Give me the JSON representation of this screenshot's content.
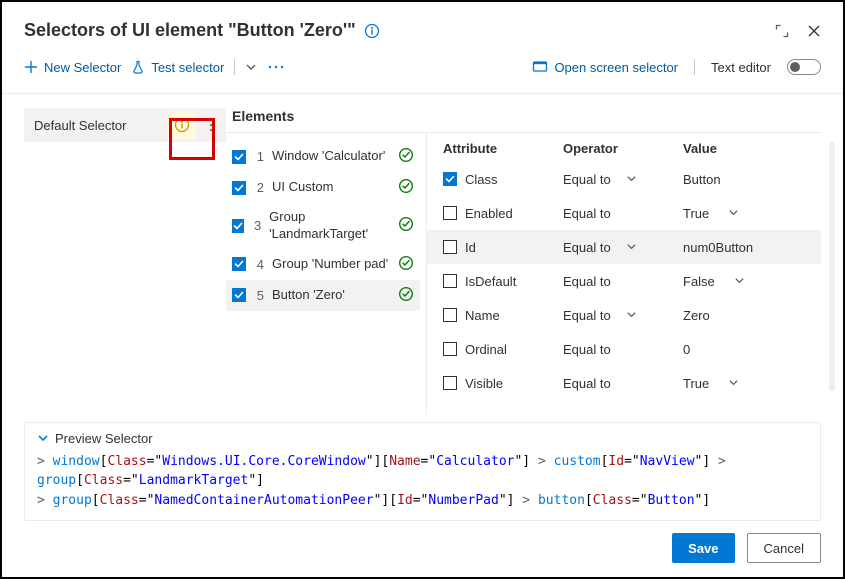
{
  "title": "Selectors of UI element \"Button 'Zero'\"",
  "toolbar": {
    "new_selector": "New Selector",
    "test_selector": "Test selector",
    "open_screen_selector": "Open screen selector",
    "text_editor": "Text editor"
  },
  "left": {
    "default_selector": "Default Selector"
  },
  "elements": {
    "header": "Elements",
    "items": [
      {
        "index": "1",
        "label": "Window 'Calculator'",
        "checked": true,
        "selected": false
      },
      {
        "index": "2",
        "label": "UI Custom",
        "checked": true,
        "selected": false
      },
      {
        "index": "3",
        "label": "Group 'LandmarkTarget'",
        "checked": true,
        "selected": false
      },
      {
        "index": "4",
        "label": "Group 'Number pad'",
        "checked": true,
        "selected": false
      },
      {
        "index": "5",
        "label": "Button 'Zero'",
        "checked": true,
        "selected": true
      }
    ]
  },
  "attrs": {
    "head_attr": "Attribute",
    "head_op": "Operator",
    "head_val": "Value",
    "rows": [
      {
        "name": "Class",
        "checked": true,
        "op": "Equal to",
        "op_chev": true,
        "val": "Button",
        "val_chev": false,
        "highlight": false
      },
      {
        "name": "Enabled",
        "checked": false,
        "op": "Equal to",
        "op_chev": false,
        "val": "True",
        "val_chev": true,
        "highlight": false
      },
      {
        "name": "Id",
        "checked": false,
        "op": "Equal to",
        "op_chev": true,
        "val": "num0Button",
        "val_chev": false,
        "highlight": true
      },
      {
        "name": "IsDefault",
        "checked": false,
        "op": "Equal to",
        "op_chev": false,
        "val": "False",
        "val_chev": true,
        "highlight": false
      },
      {
        "name": "Name",
        "checked": false,
        "op": "Equal to",
        "op_chev": true,
        "val": "Zero",
        "val_chev": false,
        "highlight": false
      },
      {
        "name": "Ordinal",
        "checked": false,
        "op": "Equal to",
        "op_chev": false,
        "val": "0",
        "val_chev": false,
        "highlight": false
      },
      {
        "name": "Visible",
        "checked": false,
        "op": "Equal to",
        "op_chev": false,
        "val": "True",
        "val_chev": true,
        "highlight": false
      }
    ]
  },
  "preview": {
    "header": "Preview Selector",
    "tokens": [
      {
        "t": "angle",
        "v": "> "
      },
      {
        "t": "tag",
        "v": "window"
      },
      {
        "t": "punc",
        "v": "["
      },
      {
        "t": "attr",
        "v": "Class"
      },
      {
        "t": "punc",
        "v": "=\""
      },
      {
        "t": "str",
        "v": "Windows.UI.Core.CoreWindow"
      },
      {
        "t": "punc",
        "v": "\"]"
      },
      {
        "t": "punc",
        "v": "["
      },
      {
        "t": "attr",
        "v": "Name"
      },
      {
        "t": "punc",
        "v": "=\""
      },
      {
        "t": "str",
        "v": "Calculator"
      },
      {
        "t": "punc",
        "v": "\"]"
      },
      {
        "t": "angle",
        "v": " > "
      },
      {
        "t": "tag",
        "v": "custom"
      },
      {
        "t": "punc",
        "v": "["
      },
      {
        "t": "attr",
        "v": "Id"
      },
      {
        "t": "punc",
        "v": "=\""
      },
      {
        "t": "str",
        "v": "NavView"
      },
      {
        "t": "punc",
        "v": "\"]"
      },
      {
        "t": "angle",
        "v": " > "
      },
      {
        "t": "tag",
        "v": "group"
      },
      {
        "t": "punc",
        "v": "["
      },
      {
        "t": "attr",
        "v": "Class"
      },
      {
        "t": "punc",
        "v": "=\""
      },
      {
        "t": "str",
        "v": "LandmarkTarget"
      },
      {
        "t": "punc",
        "v": "\"]"
      },
      {
        "t": "br"
      },
      {
        "t": "angle",
        "v": "> "
      },
      {
        "t": "tag",
        "v": "group"
      },
      {
        "t": "punc",
        "v": "["
      },
      {
        "t": "attr",
        "v": "Class"
      },
      {
        "t": "punc",
        "v": "=\""
      },
      {
        "t": "str",
        "v": "NamedContainerAutomationPeer"
      },
      {
        "t": "punc",
        "v": "\"]"
      },
      {
        "t": "punc",
        "v": "["
      },
      {
        "t": "attr",
        "v": "Id"
      },
      {
        "t": "punc",
        "v": "=\""
      },
      {
        "t": "str",
        "v": "NumberPad"
      },
      {
        "t": "punc",
        "v": "\"]"
      },
      {
        "t": "angle",
        "v": " > "
      },
      {
        "t": "tag",
        "v": "button"
      },
      {
        "t": "punc",
        "v": "["
      },
      {
        "t": "attr",
        "v": "Class"
      },
      {
        "t": "punc",
        "v": "=\""
      },
      {
        "t": "str",
        "v": "Button"
      },
      {
        "t": "punc",
        "v": "\"]"
      }
    ]
  },
  "footer": {
    "save": "Save",
    "cancel": "Cancel"
  }
}
